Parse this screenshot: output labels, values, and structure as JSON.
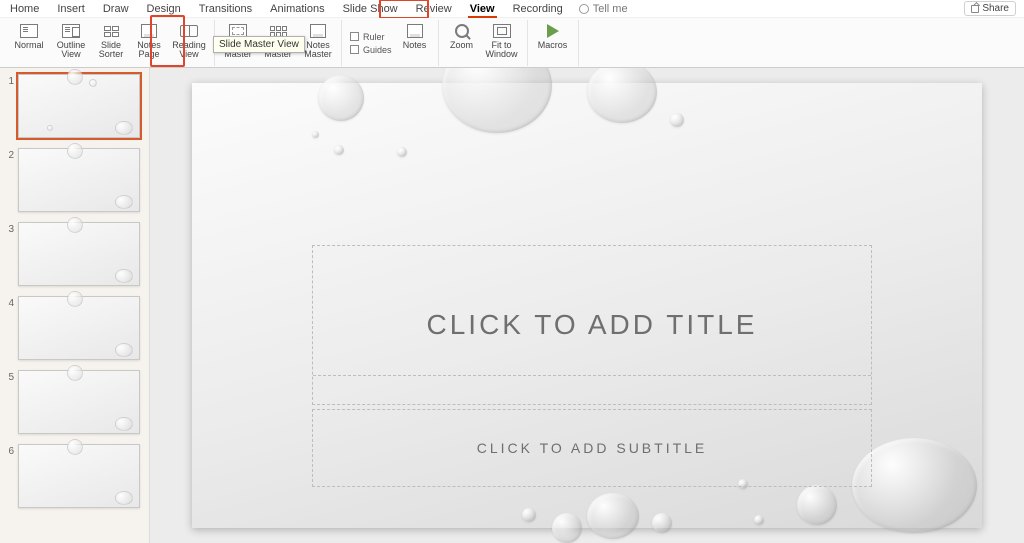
{
  "menu": {
    "items": [
      "Home",
      "Insert",
      "Draw",
      "Design",
      "Transitions",
      "Animations",
      "Slide Show",
      "Review",
      "View",
      "Recording"
    ],
    "active": "View",
    "tellme": "Tell me",
    "share": "Share"
  },
  "ribbon": {
    "presentation_views": {
      "normal": "Normal",
      "outline": "Outline View",
      "sorter": "Slide Sorter",
      "notespage": "Notes Page",
      "reading": "Reading View"
    },
    "master_views": {
      "slide_master": "Slide Master",
      "handout_master": "Handout Master",
      "notes_master": "Notes Master",
      "tooltip": "Slide Master View"
    },
    "show": {
      "ruler": "Ruler",
      "guides": "Guides",
      "notes": "Notes"
    },
    "zoom": {
      "zoom": "Zoom",
      "fit": "Fit to Window"
    },
    "macros": "Macros"
  },
  "thumbnails": [
    1,
    2,
    3,
    4,
    5,
    6
  ],
  "selected_thumb": 1,
  "slide": {
    "title_placeholder": "CLICK TO ADD TITLE",
    "subtitle_placeholder": "CLICK TO ADD SUBTITLE"
  }
}
